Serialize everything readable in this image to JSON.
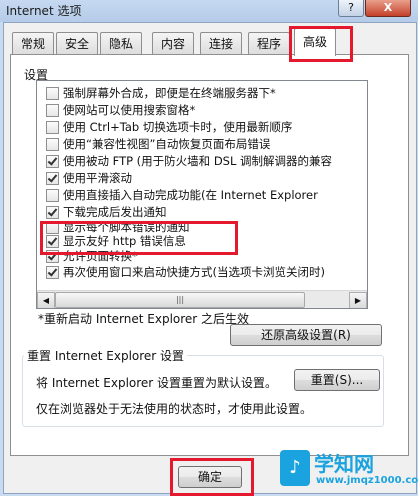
{
  "window": {
    "title": "Internet 选项",
    "help_label": "?",
    "close_label": "X"
  },
  "tabs": [
    "常规",
    "安全",
    "隐私",
    "内容",
    "连接",
    "程序",
    "高级"
  ],
  "section_label": "设置",
  "settings": [
    {
      "label": "强制屏幕外合成，即便是在终端服务器下*",
      "checked": false
    },
    {
      "label": "使网站可以使用搜索窗格*",
      "checked": false
    },
    {
      "label": "使用 Ctrl+Tab 切换选项卡时，使用最新顺序",
      "checked": false
    },
    {
      "label": "使用“兼容性视图”自动恢复页面布局错误",
      "checked": false
    },
    {
      "label": "使用被动 FTP (用于防火墙和 DSL 调制解调器的兼容",
      "checked": true
    },
    {
      "label": "使用平滑滚动",
      "checked": true
    },
    {
      "label": "使用直接插入自动完成功能(在 Internet Explorer",
      "checked": false
    },
    {
      "label": "下载完成后发出通知",
      "checked": true
    },
    {
      "label": "显示每个脚本错误的通知",
      "checked": false
    },
    {
      "label": "显示友好 http 错误信息",
      "checked": true
    },
    {
      "label": "允许页面转换*",
      "checked": true
    },
    {
      "label": "再次使用窗口来启动快捷方式(当选项卡浏览关闭时)",
      "checked": true
    }
  ],
  "scrollbar": {
    "left_arrow": "◀",
    "right_arrow": "▶",
    "grip": "|||"
  },
  "restart_note": "*重新启动 Internet Explorer 之后生效",
  "restore_button": "还原高级设置(R)",
  "reset_group_title": "重置 Internet Explorer 设置",
  "reset_text": "将 Internet Explorer 设置重置为默认设置。",
  "reset_button": "重置(S)...",
  "reset_warning": "仅在浏览器处于无法使用的状态时，才使用此设置。",
  "ok_button": "确定",
  "watermark": {
    "logo": "♪",
    "title": "学知网",
    "url": "www.jmqz1000.com"
  },
  "colors": {
    "highlight": "#e4192d",
    "watermark": "#1aa3de"
  }
}
